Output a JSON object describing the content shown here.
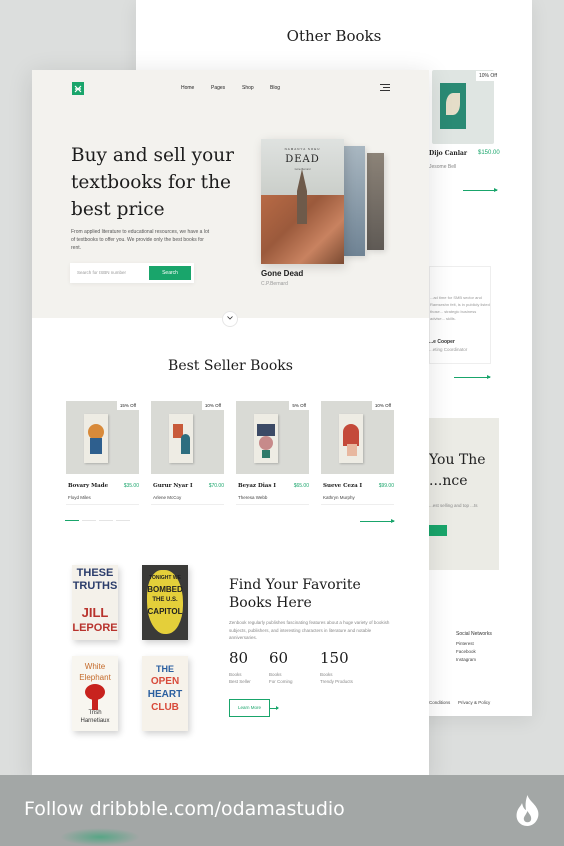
{
  "back_page": {
    "title": "Other Books",
    "book_badge": "10% Off",
    "book_name": "Dijo Canlar",
    "book_price": "$150.00",
    "book_author": "Jesome Bell",
    "testimonial_text": "...ad time for SMB sector and Ramseshn felt, is in publicly listed those... strategic business advise... skills.",
    "testimonial_name": "...e Cooper",
    "testimonial_role": "...eting Coordinator",
    "cta_title": "You The ...nce",
    "cta_text": "...est selling and top ...ts",
    "social_title": "Social Networks",
    "social_links": [
      "Pinterest",
      "Facebook",
      "Instagram"
    ],
    "legal": [
      "Conditions",
      "Privacy & Policy"
    ]
  },
  "nav": {
    "items": [
      "Home",
      "Pages",
      "Shop",
      "Blog"
    ]
  },
  "hero": {
    "title": "Buy and sell your textbooks for the best price",
    "text": "From applied literature to educational resources, we have a lot of textbooks to offer you. We provide only the best books for rent.",
    "search_placeholder": "Search for ISBN number",
    "search_button": "Search",
    "featured_book": {
      "cover_top": "NAMANYA SOEU",
      "cover_title": "DEAD",
      "cover_sub": "Gone Bernard",
      "title": "Gone Dead",
      "author": "C.P.Bernard"
    }
  },
  "best_seller": {
    "title": "Best Seller Books",
    "books": [
      {
        "badge": "15% Off",
        "title": "Bovary Made",
        "price": "$35.00",
        "author": "Floyd Miles"
      },
      {
        "badge": "10% Off",
        "title": "Gurur Nyar I",
        "price": "$70.00",
        "author": "Arlene McCoy"
      },
      {
        "badge": "5% Off",
        "title": "Beyaz Dias I",
        "price": "$65.00",
        "author": "Theresa Webb"
      },
      {
        "badge": "10% Off",
        "title": "Sueve Ceza I",
        "price": "$99.00",
        "author": "Kathryn Murphy"
      }
    ]
  },
  "favorites": {
    "covers": [
      {
        "line1": "THESE",
        "line2": "TRUTHS",
        "line3": "JILL",
        "line4": "LEPORE"
      },
      {
        "line1": "TONIGHT WE",
        "line2": "BOMBED",
        "line3": "THE U.S.",
        "line4": "CAPITOL"
      },
      {
        "line1": "White",
        "line2": "Elephant",
        "line3": "Trish",
        "line4": "Harnetiaux"
      },
      {
        "line1": "THE",
        "line2": "OPEN",
        "line3": "HEART",
        "line4": "CLUB"
      }
    ],
    "title": "Find Your Favorite Books Here",
    "text": "Zenbook regularly publishes fascinating features about a huge variety of bookish subjects, publishers, and interesting characters in literature and notable anniversaries.",
    "stats": [
      {
        "num": "80",
        "l1": "Books",
        "l2": "Best Seller"
      },
      {
        "num": "60",
        "l1": "Books",
        "l2": "For Coming"
      },
      {
        "num": "150",
        "l1": "Books",
        "l2": "Trendy Products"
      }
    ],
    "button": "Learn More"
  },
  "footer": {
    "text": "Follow dribbble.com/odamastudio"
  },
  "colors": {
    "accent": "#19a56b",
    "hero_bg": "#f3f2ee",
    "footer_bg": "#a3a7a6"
  }
}
